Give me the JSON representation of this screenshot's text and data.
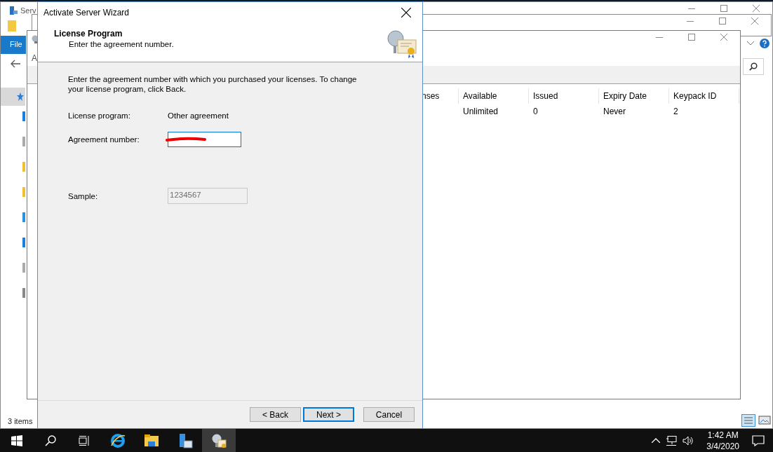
{
  "explorer_window": {
    "title": "Serv",
    "ribbon_tab": "File",
    "status": "3 items"
  },
  "licensing_window": {
    "menu_item": "A",
    "columns": [
      "nses",
      "Available",
      "Issued",
      "Expiry Date",
      "Keypack ID"
    ],
    "rows": [
      [
        "",
        "Unlimited",
        "0",
        "Never",
        "2"
      ]
    ]
  },
  "wizard": {
    "title": "Activate Server Wizard",
    "heading": "License Program",
    "subheading": "Enter the agreement number.",
    "instructions": "Enter the agreement number with which you purchased your licenses. To change your license program, click Back.",
    "fields": [
      {
        "label": "License program:",
        "kind": "text",
        "value": "Other agreement"
      },
      {
        "label": "Agreement number:",
        "kind": "input",
        "focused": true,
        "redacted": true
      },
      {
        "label": "Sample:",
        "kind": "readonly",
        "value": "1234567"
      }
    ],
    "buttons": [
      {
        "label": "< Back",
        "default": false
      },
      {
        "label": "Next >",
        "default": true
      },
      {
        "label": "Cancel",
        "default": false
      }
    ]
  },
  "taskbar": {
    "apps": [
      {
        "kind": "ie",
        "active": false
      },
      {
        "kind": "folder",
        "active": false
      },
      {
        "kind": "server",
        "active": false
      },
      {
        "kind": "licensing",
        "active": true
      }
    ],
    "time": "1:42 AM",
    "date": "3/4/2020"
  }
}
